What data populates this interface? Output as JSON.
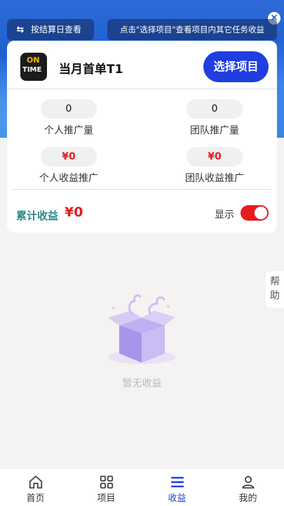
{
  "header": {
    "toggle_label": "按结算日查看",
    "tip": "点击\"选择项目\"查看项目内其它任务收益",
    "close": "×"
  },
  "project": {
    "logo_top": "ON",
    "logo_bottom": "TIME",
    "name": "当月首单T1",
    "select_label": "选择项目"
  },
  "stats": [
    {
      "value": "0",
      "label": "个人推广量"
    },
    {
      "value": "0",
      "label": "团队推广量"
    },
    {
      "value": "¥0",
      "label": "个人收益推广"
    },
    {
      "value": "¥0",
      "label": "团队收益推广"
    }
  ],
  "total": {
    "label": "累计收益",
    "value": "¥0",
    "show_label": "显示",
    "show_on": true
  },
  "help": {
    "line1": "帮",
    "line2": "助"
  },
  "empty": {
    "text": "暂无收益"
  },
  "tabs": [
    {
      "label": "首页",
      "icon": "home-icon",
      "active": false
    },
    {
      "label": "项目",
      "icon": "grid-icon",
      "active": false
    },
    {
      "label": "收益",
      "icon": "menu-icon",
      "active": true
    },
    {
      "label": "我的",
      "icon": "user-icon",
      "active": false
    }
  ],
  "colors": {
    "primary": "#1f3ee0",
    "accent_red": "#e41c1c",
    "teal": "#2b8a8a"
  }
}
